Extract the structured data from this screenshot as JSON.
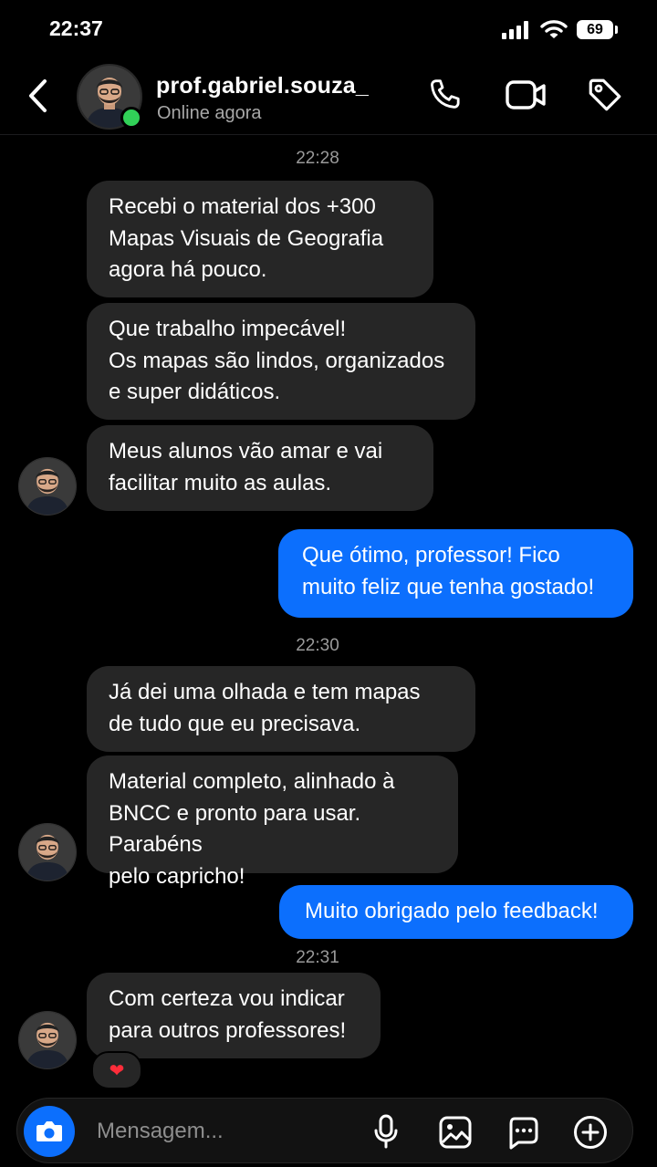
{
  "status_bar": {
    "time": "22:37",
    "battery": "69"
  },
  "header": {
    "back_icon": "chevron-left-icon",
    "username": "prof.gabriel.souza_",
    "presence": "Online agora",
    "actions": [
      "phone-icon",
      "video-icon",
      "tag-icon"
    ]
  },
  "timestamps": [
    "22:28",
    "22:30",
    "22:31"
  ],
  "messages": [
    {
      "from": "in",
      "text": "Recebi o material dos +300\nMapas Visuais de Geografia\nagora há pouco."
    },
    {
      "from": "in",
      "text": "Que trabalho impecável!\nOs mapas são lindos, organizados\ne super didáticos."
    },
    {
      "from": "in",
      "text": "Meus alunos vão amar e vai\nfacilitar muito as aulas."
    },
    {
      "from": "out",
      "text": "Que ótimo, professor! Fico\nmuito feliz que tenha gostado!"
    },
    {
      "from": "in",
      "text": "Já dei uma olhada e tem mapas\nde tudo que eu precisava."
    },
    {
      "from": "in",
      "text": "Material completo, alinhado à\nBNCC e pronto para usar. Parabéns\npelo capricho!"
    },
    {
      "from": "out",
      "text": "Muito obrigado pelo feedback!"
    },
    {
      "from": "in",
      "text": "Com certeza vou indicar\npara outros professores!"
    }
  ],
  "reaction": {
    "emoji": "❤"
  },
  "composer": {
    "placeholder": "Mensagem...",
    "icons": [
      "camera-icon",
      "microphone-icon",
      "image-icon",
      "sticker-icon",
      "plus-circle-icon"
    ]
  },
  "colors": {
    "outgoing": "#0c6ffd",
    "incoming": "#262626",
    "online": "#31d158"
  }
}
